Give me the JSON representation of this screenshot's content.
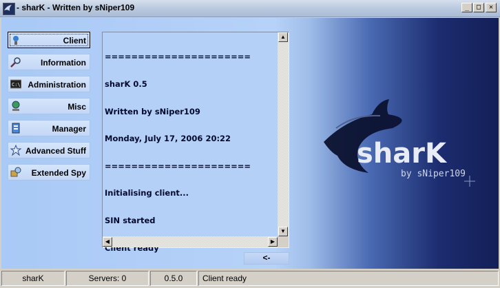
{
  "window": {
    "title": "- sharK - Written by sNiper109",
    "minimize": "_",
    "maximize": "□",
    "close": "✕"
  },
  "nav": [
    {
      "label": "Client",
      "icon": "client-icon"
    },
    {
      "label": "Information",
      "icon": "magnifier-icon"
    },
    {
      "label": "Administration",
      "icon": "console-icon"
    },
    {
      "label": "Misc",
      "icon": "globe-icon"
    },
    {
      "label": "Manager",
      "icon": "manager-icon"
    },
    {
      "label": "Advanced Stuff",
      "icon": "star-icon"
    },
    {
      "label": "Extended Spy",
      "icon": "spy-icon"
    }
  ],
  "log": {
    "lines": [
      "======================",
      "sharK 0.5",
      "Written by sNiper109",
      "Monday, July 17, 2006 20:22",
      "======================",
      "Initialising client...",
      "SIN started",
      "Client ready"
    ]
  },
  "back_button": "<-",
  "logo": {
    "wordmark": "sharK",
    "byline": "by sNiper109"
  },
  "status": {
    "app": "sharK",
    "servers": "Servers: 0",
    "version": "0.5.0",
    "message": "Client ready"
  },
  "colors": {
    "client_gradient_light": "#b6d2f8",
    "client_gradient_dark": "#131f57",
    "log_background": "#b4d0f7"
  }
}
